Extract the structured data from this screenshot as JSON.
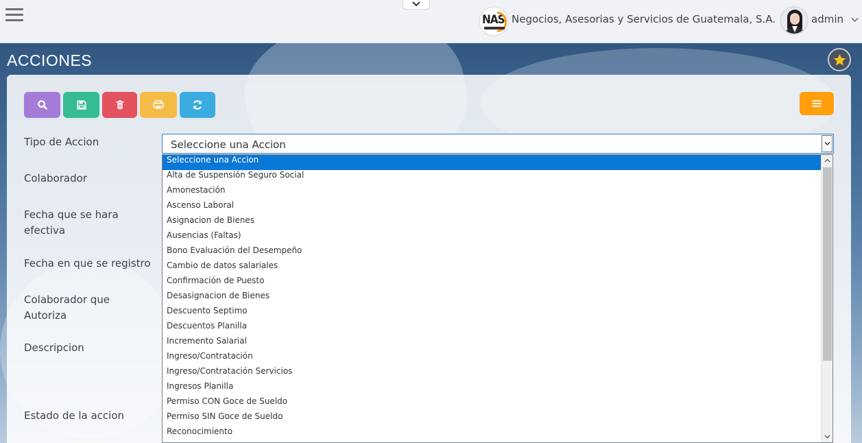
{
  "topbar": {
    "company_name": "Negocios, Asesorias y Servicios de Guatemala, S.A.",
    "company_logo_text": "NAS",
    "user_name": "admin"
  },
  "page": {
    "title": "ACCIONES"
  },
  "toolbar": {
    "icons": [
      "search-icon",
      "save-icon",
      "trash-icon",
      "print-icon",
      "refresh-icon",
      "menu-icon"
    ],
    "colors": {
      "search": "#a57bd8",
      "save": "#35bc91",
      "delete": "#e2525f",
      "print": "#f5bc45",
      "refresh": "#3bacdf",
      "menu": "#ff9f0e"
    }
  },
  "form": {
    "labels": {
      "tipo_accion": "Tipo de Accion",
      "colaborador": "Colaborador",
      "fecha_efectiva": "Fecha que se hara efectiva",
      "fecha_registro": "Fecha en que se registro",
      "colaborador_autoriza": "Colaborador que Autoriza",
      "descripcion": "Descripcion",
      "estado": "Estado de la accion"
    },
    "tipo_accion_value": "Seleccione una Accion"
  },
  "dropdown": {
    "options": [
      "Seleccione una Accion",
      "Alta de Suspensión Seguro Social",
      "Amonestación",
      "Ascenso Laboral",
      "Asignacion de Bienes",
      "Ausencias (Faltas)",
      "Bono Evaluación del Desempeño",
      "Cambio de datos salariales",
      "Confirmación de Puesto",
      "Desasignacion de Bienes",
      "Descuento Septimo",
      "Descuentos Planilla",
      "Incremento Salarial",
      "Ingreso/Contratación",
      "Ingreso/Contratación Servicios",
      "Ingresos Planilla",
      "Permiso CON Goce de Sueldo",
      "Permiso SIN Goce de Sueldo",
      "Reconocimiento"
    ],
    "selected_index": 0
  }
}
